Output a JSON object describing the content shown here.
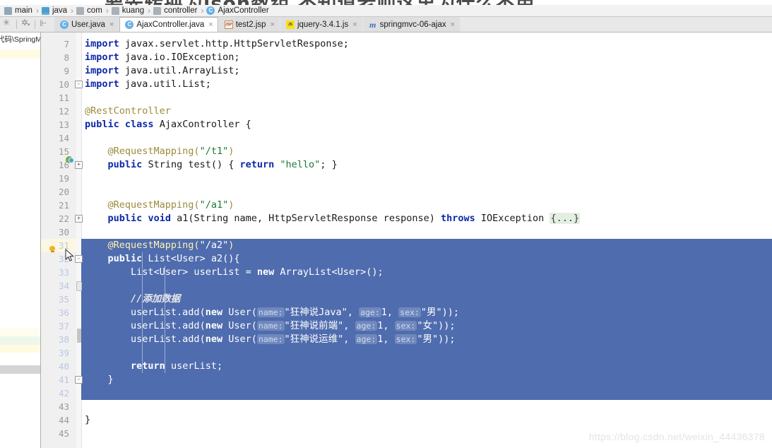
{
  "overlay": {
    "banner_text": "要先转换为json数组  不知道老师这里为什么不用"
  },
  "breadcrumb": {
    "name": "breadcrumb",
    "items": [
      {
        "label": "main",
        "icon": "folder-src-icon"
      },
      {
        "label": "java",
        "icon": "folder-blue-icon"
      },
      {
        "label": "com",
        "icon": "folder-grey-icon"
      },
      {
        "label": "kuang",
        "icon": "folder-grey-icon"
      },
      {
        "label": "controller",
        "icon": "folder-grey-icon"
      },
      {
        "label": "AjaxController",
        "icon": "java-class-icon"
      }
    ],
    "separator": "›"
  },
  "toolbar": {
    "icons": [
      "select-opened-file-icon",
      "settings-gear-icon",
      "collapse-all-icon"
    ]
  },
  "tabs": [
    {
      "label": "User.java",
      "icon": "java-class-icon",
      "icon_glyph": "C",
      "kind": "java",
      "active": false,
      "close": "×"
    },
    {
      "label": "AjaxController.java",
      "icon": "java-class-icon",
      "icon_glyph": "C",
      "kind": "java",
      "active": true,
      "close": "×"
    },
    {
      "label": "test2.jsp",
      "icon": "jsp-file-icon",
      "icon_glyph": "JSP",
      "kind": "jsp",
      "active": false,
      "close": "×"
    },
    {
      "label": "jquery-3.4.1.js",
      "icon": "js-file-icon",
      "icon_glyph": "JS",
      "kind": "js",
      "active": false,
      "close": "×"
    },
    {
      "label": "springmvc-06-ajax",
      "icon": "maven-module-icon",
      "icon_glyph": "m",
      "kind": "maven",
      "active": false,
      "close": "×"
    }
  ],
  "left_panel": {
    "path_label": "代码\\SpringM"
  },
  "editor": {
    "current_line": 31,
    "selection_color": "#4f6cae",
    "current_line_color": "#fcf7e2",
    "lines": [
      {
        "num": 7,
        "fold": "",
        "selected": false,
        "html": "<span class=\"kw\">import</span> <span class=\"id\">javax.servlet.http.HttpServletResponse;</span>"
      },
      {
        "num": 8,
        "fold": "",
        "selected": false,
        "html": "<span class=\"kw\">import</span> <span class=\"id\">java.io.IOException;</span>"
      },
      {
        "num": 9,
        "fold": "",
        "selected": false,
        "html": "<span class=\"kw\">import</span> <span class=\"id\">java.util.ArrayList;</span>"
      },
      {
        "num": 10,
        "fold": "-",
        "selected": false,
        "html": "<span class=\"kw\">import</span> <span class=\"id\">java.util.List;</span>"
      },
      {
        "num": 11,
        "fold": "",
        "selected": false,
        "html": ""
      },
      {
        "num": 12,
        "fold": "",
        "selected": false,
        "html": "<span class=\"ann\">@RestController</span>"
      },
      {
        "num": 13,
        "fold": "",
        "selected": false,
        "html": "<span class=\"kw\">public</span> <span class=\"kw\">class</span> <span class=\"id\">AjaxController {</span>"
      },
      {
        "num": 14,
        "fold": "",
        "selected": false,
        "html": ""
      },
      {
        "num": 15,
        "fold": "",
        "selected": false,
        "html": "    <span class=\"ann\">@RequestMapping(</span><span class=\"str\">\"/t1\"</span><span class=\"ann\">)</span>"
      },
      {
        "num": 16,
        "fold": "+",
        "selected": false,
        "html": "    <span class=\"kw\">public</span> <span class=\"id\">String test() {</span> <span class=\"kw\">return</span> <span class=\"str\">\"hello\"</span><span class=\"id\">; }</span>"
      },
      {
        "num": 19,
        "fold": "",
        "selected": false,
        "html": ""
      },
      {
        "num": 20,
        "fold": "",
        "selected": false,
        "html": ""
      },
      {
        "num": 21,
        "fold": "",
        "selected": false,
        "html": "    <span class=\"ann\">@RequestMapping(</span><span class=\"str\">\"/a1\"</span><span class=\"ann\">)</span>"
      },
      {
        "num": 22,
        "fold": "+",
        "selected": false,
        "html": "    <span class=\"kw\">public</span> <span class=\"kw\">void</span> <span class=\"id\">a1(String name, HttpServletResponse response)</span> <span class=\"kw\">throws</span> <span class=\"id\">IOException</span> <span class=\"fold\">{...}</span>"
      },
      {
        "num": 30,
        "fold": "",
        "selected": false,
        "html": ""
      },
      {
        "num": 31,
        "fold": "",
        "selected": true,
        "html": "    <span class=\"ann\">@RequestMapping(</span><span class=\"str\">\"/a2\"</span><span class=\"ann\">)</span>"
      },
      {
        "num": 32,
        "fold": "-",
        "selected": true,
        "html": "    <span class=\"kw\">public</span> <span class=\"id\">List&lt;User&gt; a2(){</span>"
      },
      {
        "num": 33,
        "fold": "",
        "selected": true,
        "html": "        <span class=\"id\">List&lt;User&gt; userList = </span><span class=\"kw\">new</span> <span class=\"id\">ArrayList&lt;User&gt;();</span>"
      },
      {
        "num": 34,
        "fold": "",
        "selected": true,
        "html": ""
      },
      {
        "num": 35,
        "fold": "",
        "selected": true,
        "html": "        <span class=\"cmt\">//添加数据</span>"
      },
      {
        "num": 36,
        "fold": "",
        "selected": true,
        "html": "        <span class=\"id\">userList.add(</span><span class=\"kw\">new</span> <span class=\"id\">User(</span><span class=\"hint\">name:</span><span class=\"str\">\"狂神说Java\"</span><span class=\"id\">, </span><span class=\"hint\">age:</span><span class=\"num\">1</span><span class=\"id\">, </span><span class=\"hint\">sex:</span><span class=\"str\">\"男\"</span><span class=\"id\">));</span>"
      },
      {
        "num": 37,
        "fold": "",
        "selected": true,
        "html": "        <span class=\"id\">userList.add(</span><span class=\"kw\">new</span> <span class=\"id\">User(</span><span class=\"hint\">name:</span><span class=\"str\">\"狂神说前端\"</span><span class=\"id\">, </span><span class=\"hint\">age:</span><span class=\"num\">1</span><span class=\"id\">, </span><span class=\"hint\">sex:</span><span class=\"str\">\"女\"</span><span class=\"id\">));</span>"
      },
      {
        "num": 38,
        "fold": "",
        "selected": true,
        "html": "        <span class=\"id\">userList.add(</span><span class=\"kw\">new</span> <span class=\"id\">User(</span><span class=\"hint\">name:</span><span class=\"str\">\"狂神说运维\"</span><span class=\"id\">, </span><span class=\"hint\">age:</span><span class=\"num\">1</span><span class=\"id\">, </span><span class=\"hint\">sex:</span><span class=\"str\">\"男\"</span><span class=\"id\">));</span>"
      },
      {
        "num": 39,
        "fold": "",
        "selected": true,
        "html": ""
      },
      {
        "num": 40,
        "fold": "",
        "selected": true,
        "html": "        <span class=\"kw\">return</span> <span class=\"id\">userList;</span>"
      },
      {
        "num": 41,
        "fold": "-",
        "selected": true,
        "html": "    <span class=\"id\">}</span>"
      },
      {
        "num": 42,
        "fold": "",
        "selected": true,
        "html": ""
      },
      {
        "num": 43,
        "fold": "",
        "selected": false,
        "html": ""
      },
      {
        "num": 44,
        "fold": "",
        "selected": false,
        "html": "<span class=\"id\">}</span>"
      },
      {
        "num": 45,
        "fold": "",
        "selected": false,
        "html": ""
      }
    ]
  },
  "watermark": {
    "text": "https://blog.csdn.net/weixin_44436378"
  }
}
